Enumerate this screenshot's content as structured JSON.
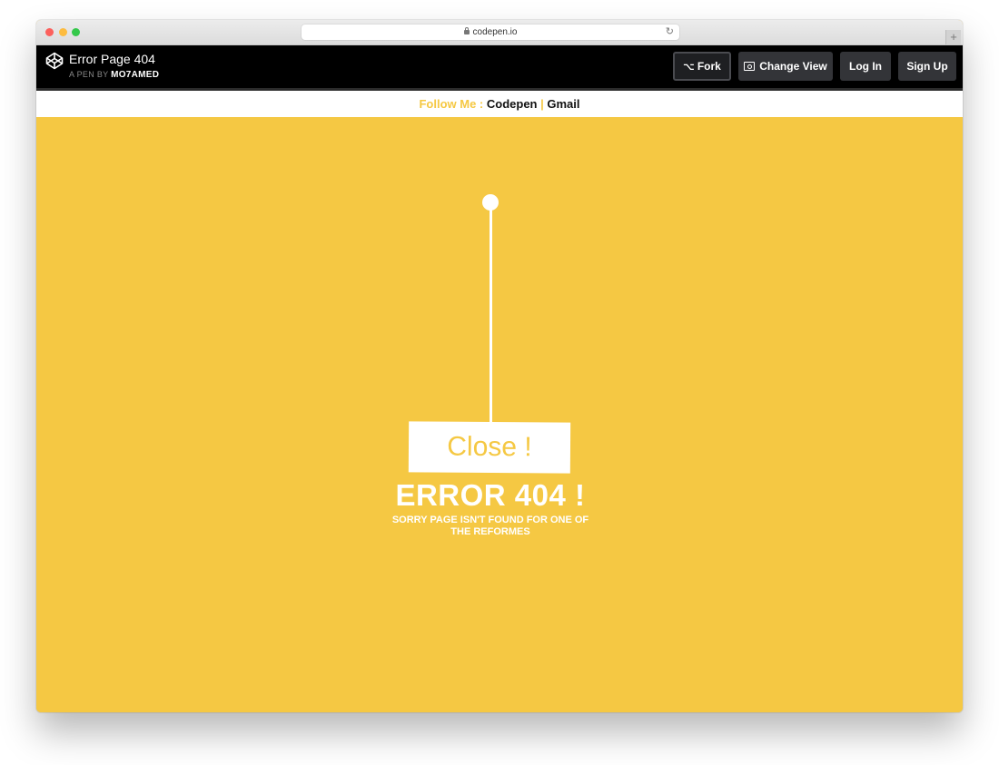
{
  "browser": {
    "url": "codepen.io",
    "new_tab_label": "+"
  },
  "header": {
    "title": "Error Page 404",
    "byline_prefix": "A PEN BY",
    "author": "MO7AMED",
    "buttons": {
      "fork": "Fork",
      "change_view": "Change View",
      "login": "Log In",
      "signup": "Sign Up"
    }
  },
  "follow": {
    "label": "Follow Me :",
    "links": [
      "Codepen",
      "Gmail"
    ],
    "separator": "|"
  },
  "main": {
    "sign_text": "Close !",
    "error_title": "ERROR 404 !",
    "error_subtitle": "SORRY PAGE ISN'T FOUND FOR ONE OF THE REFORMES"
  },
  "colors": {
    "accent": "#f5c843",
    "header_bg": "#000000",
    "button_bg": "#333438"
  },
  "icons": {
    "logo": "codepen-logo-icon",
    "lock": "lock-icon",
    "reload": "reload-icon",
    "fork": "fork-icon",
    "change_view": "view-icon"
  }
}
